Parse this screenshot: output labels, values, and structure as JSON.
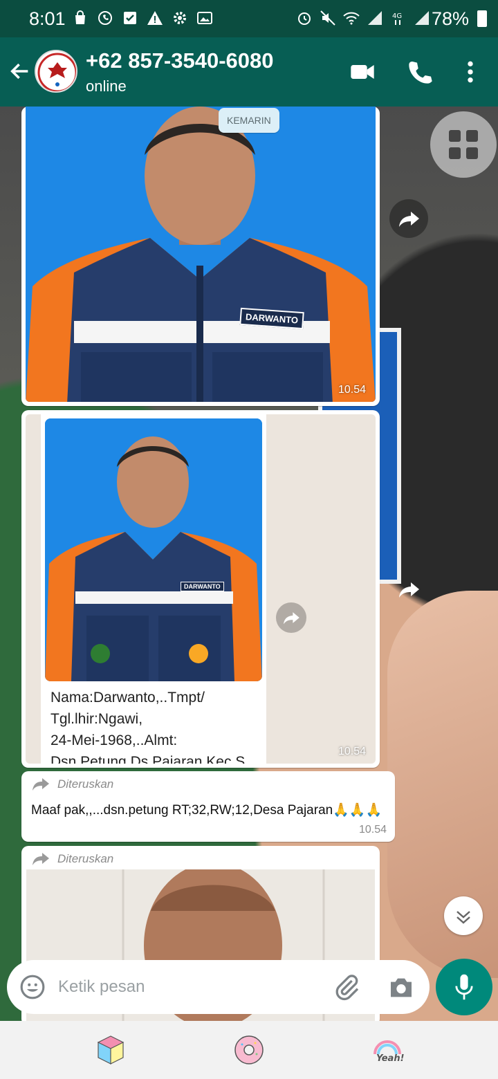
{
  "status_bar": {
    "time": "8:01",
    "battery": "78%",
    "network": "4G"
  },
  "header": {
    "contact_name": "+62 857-3540-6080",
    "contact_status": "online"
  },
  "chat": {
    "date_chip": "KEMARIN",
    "messages": [
      {
        "type": "image",
        "time": "10.54",
        "badge": "DARWANTO"
      },
      {
        "type": "image_with_caption",
        "time": "10.54",
        "badge": "DARWANTO",
        "caption_lines": [
          "Nama:Darwanto,..Tmpt/",
          "Tgl.lhir:Ngawi,",
          "24-Mei-1968,..Almt:",
          "Dsn.Petung.Ds.Pajaran.Kec.S"
        ]
      },
      {
        "type": "text",
        "forwarded_label": "Diteruskan",
        "text": "Maaf pak,,...dsn.petung RT;32,RW;12,Desa Pajaran🙏🙏🙏",
        "time": "10.54"
      },
      {
        "type": "image",
        "forwarded_label": "Diteruskan"
      }
    ]
  },
  "input": {
    "placeholder": "Ketik pesan"
  },
  "colors": {
    "header": "#075e54",
    "status_bar": "#0b4d40",
    "accent": "#00897b"
  }
}
